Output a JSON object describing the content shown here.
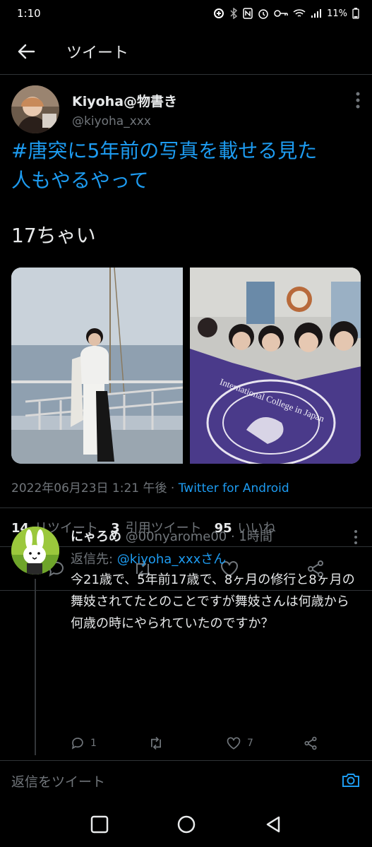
{
  "status_bar": {
    "time": "1:10",
    "battery": "11%"
  },
  "header": {
    "title": "ツイート"
  },
  "tweet": {
    "display_name": "Kiyoha@物書き",
    "handle": "@kiyoha_xxx",
    "text_line1": "#唐突に5年前の写真を載せる見た",
    "text_line2": "人もやるやって",
    "text_body": "17ちゃい",
    "timestamp": "2022年06月23日 1:21 午後 · ",
    "source": "Twitter for Android",
    "retweets_count": "14",
    "retweets_label": "リツイート",
    "quotes_count": "3",
    "quotes_label": "引用ツイート",
    "likes_count": "95",
    "likes_label": "いいね",
    "banner_text": "International College in Japan"
  },
  "reply": {
    "display_name": "にゃろめ",
    "handle_time": "@00nyarome00 · 1時間",
    "reply_to_prefix": "返信先: ",
    "reply_to_mention": "@kiyoha_xxxさん",
    "text": "今21歳で、5年前17歳で、8ヶ月の修行と8ヶ月の舞妓されてたとのことですが舞妓さんは何歳から何歳の時にやられていたのですか？",
    "reply_count": "1",
    "like_count": "7"
  },
  "composer": {
    "placeholder": "返信をツイート"
  },
  "colors": {
    "accent": "#1d9bf0",
    "background": "#000000",
    "muted": "#71767b"
  }
}
